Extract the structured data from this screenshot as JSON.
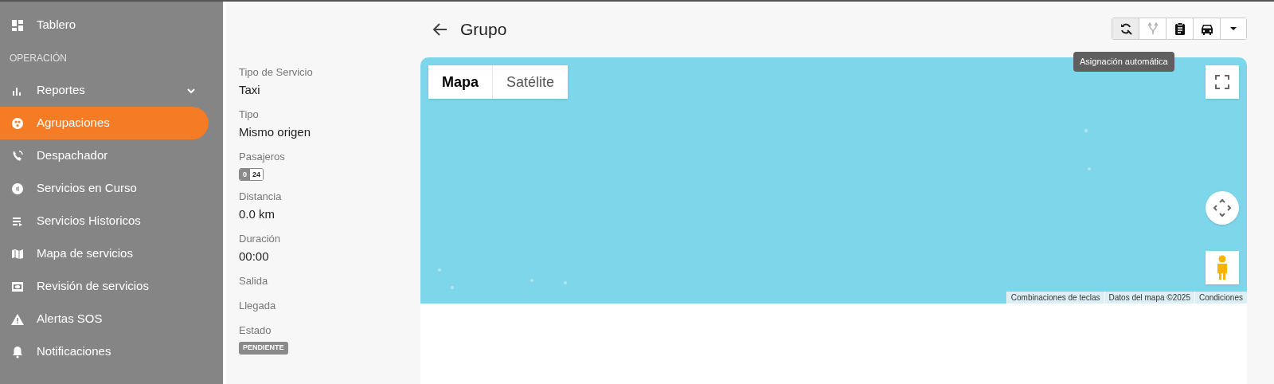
{
  "sidebar": {
    "items": [
      {
        "kind": "item",
        "label": "Tablero",
        "selected": false
      },
      {
        "kind": "section",
        "label": "OPERACIÓN"
      },
      {
        "kind": "item",
        "label": "Reportes",
        "selected": false,
        "expanded": false
      },
      {
        "kind": "item",
        "label": "Agrupaciones",
        "selected": true
      },
      {
        "kind": "item",
        "label": "Despachador",
        "selected": false
      },
      {
        "kind": "item",
        "label": "Servicios en Curso",
        "selected": false
      },
      {
        "kind": "item",
        "label": "Servicios Historicos",
        "selected": false
      },
      {
        "kind": "item",
        "label": "Mapa de servicios",
        "selected": false
      },
      {
        "kind": "item",
        "label": "Revisión de servicios",
        "selected": false
      },
      {
        "kind": "item",
        "label": "Alertas SOS",
        "selected": false
      },
      {
        "kind": "item",
        "label": "Notificaciones",
        "selected": false
      }
    ]
  },
  "details": [
    {
      "label": "Tipo de Servicio",
      "kind": "text",
      "value": "Taxi"
    },
    {
      "label": "Tipo",
      "kind": "text",
      "value": "Mismo origen"
    },
    {
      "label": "Pasajeros",
      "kind": "counter",
      "values": [
        "0",
        "24"
      ]
    },
    {
      "label": "Distancia",
      "kind": "text",
      "value": "0.0 km"
    },
    {
      "label": "Duración",
      "kind": "text",
      "value": "00:00"
    },
    {
      "label": "Salida",
      "kind": "empty"
    },
    {
      "label": "Llegada",
      "kind": "empty"
    },
    {
      "label": "Estado",
      "kind": "badge",
      "value": "PENDIENTE"
    }
  ],
  "header": {
    "title": "Grupo"
  },
  "toolbar": {
    "buttons": [
      {
        "disabled": false,
        "active": true
      },
      {
        "disabled": true,
        "active": false
      },
      {
        "disabled": false,
        "active": false
      },
      {
        "disabled": false,
        "active": false
      },
      {
        "disabled": false,
        "active": false
      }
    ],
    "tooltip": "Asignación automática"
  },
  "map": {
    "kind": "picture",
    "tabs": [
      {
        "label": "Mapa",
        "selected": true
      },
      {
        "label": "Satélite",
        "selected": false
      }
    ],
    "footer": [
      "Combinaciones de teclas",
      "Datos del mapa ©2025",
      "Condiciones"
    ]
  }
}
